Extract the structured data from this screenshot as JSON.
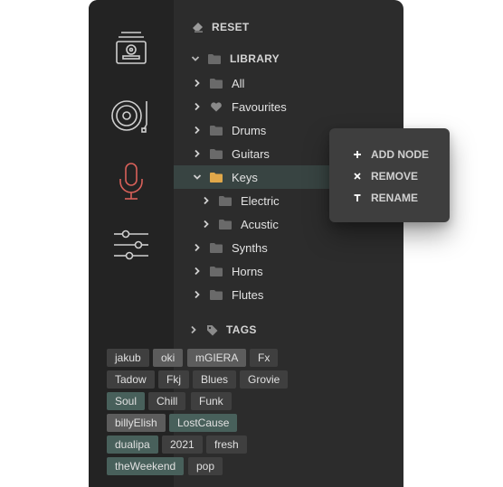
{
  "colors": {
    "rail_bg": "#232323",
    "panel_bg": "#2c2c2c",
    "selected_bg": "#384442",
    "accent_mic": "#d9615a",
    "folder_open": "#e0a84a",
    "tag_teal": "#48605b",
    "menu_bg": "#3e3e3e"
  },
  "rail": {
    "items": [
      {
        "icon": "media-library-icon"
      },
      {
        "icon": "vinyl-record-icon"
      },
      {
        "icon": "microphone-icon",
        "active": true
      },
      {
        "icon": "sliders-icon"
      }
    ]
  },
  "panel": {
    "reset_label": "RESET",
    "library_label": "LIBRARY",
    "tree": [
      {
        "label": "All"
      },
      {
        "label": "Favourites"
      },
      {
        "label": "Drums"
      },
      {
        "label": "Guitars"
      },
      {
        "label": "Keys",
        "expanded": true,
        "selected": true
      },
      {
        "label": "Electric"
      },
      {
        "label": "Acustic"
      },
      {
        "label": "Synths"
      },
      {
        "label": "Horns"
      },
      {
        "label": "Flutes"
      }
    ],
    "tags_label": "TAGS",
    "tags": [
      {
        "label": "jakub",
        "style": "dark"
      },
      {
        "label": "oki",
        "style": "gray"
      },
      {
        "label": "mGIERA",
        "style": "gray"
      },
      {
        "label": "Fx",
        "style": "dark"
      },
      {
        "label": "Tadow",
        "style": "dark"
      },
      {
        "label": "Fkj",
        "style": "dark"
      },
      {
        "label": "Blues",
        "style": "dark"
      },
      {
        "label": "Grovie",
        "style": "dark"
      },
      {
        "label": "Soul",
        "style": "teal"
      },
      {
        "label": "Chill",
        "style": "dark"
      },
      {
        "label": "Funk",
        "style": "dark"
      },
      {
        "label": "billyElish",
        "style": "gray"
      },
      {
        "label": "LostCause",
        "style": "teal"
      },
      {
        "label": "dualipa",
        "style": "teal"
      },
      {
        "label": "2021",
        "style": "dark"
      },
      {
        "label": "fresh",
        "style": "dark"
      },
      {
        "label": "theWeekend",
        "style": "teal"
      },
      {
        "label": "pop",
        "style": "dark"
      }
    ]
  },
  "context_menu": {
    "items": [
      {
        "label": "ADD NODE",
        "icon": "plus-icon"
      },
      {
        "label": "REMOVE",
        "icon": "close-icon"
      },
      {
        "label": "RENAME",
        "icon": "text-cursor-icon"
      }
    ]
  }
}
